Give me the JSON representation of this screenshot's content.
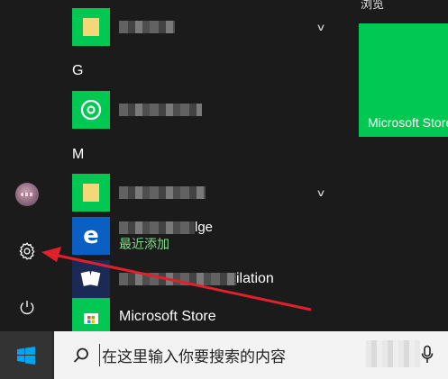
{
  "left_rail": {
    "items": [
      {
        "name": "user-avatar"
      },
      {
        "name": "settings",
        "icon": "gear-icon"
      },
      {
        "name": "power",
        "icon": "power-icon"
      }
    ]
  },
  "app_list": {
    "row_top": {
      "label_suffix": "浏览"
    },
    "letters": {
      "g": "G",
      "m": "M"
    },
    "recent_label": "最近添加",
    "app_partial_suffix": "ilation",
    "app_partial_suffix2": "lge",
    "microsoft_store_label": "Microsoft Store"
  },
  "tiles": {
    "header": "浏览",
    "microsoft_store": "Microsoft Store",
    "tile_color": "#00c853"
  },
  "taskbar": {
    "search_placeholder": "在这里输入你要搜索的内容",
    "accent": "#00a4ef"
  },
  "annotation": {
    "arrow_color": "#e0212b"
  }
}
